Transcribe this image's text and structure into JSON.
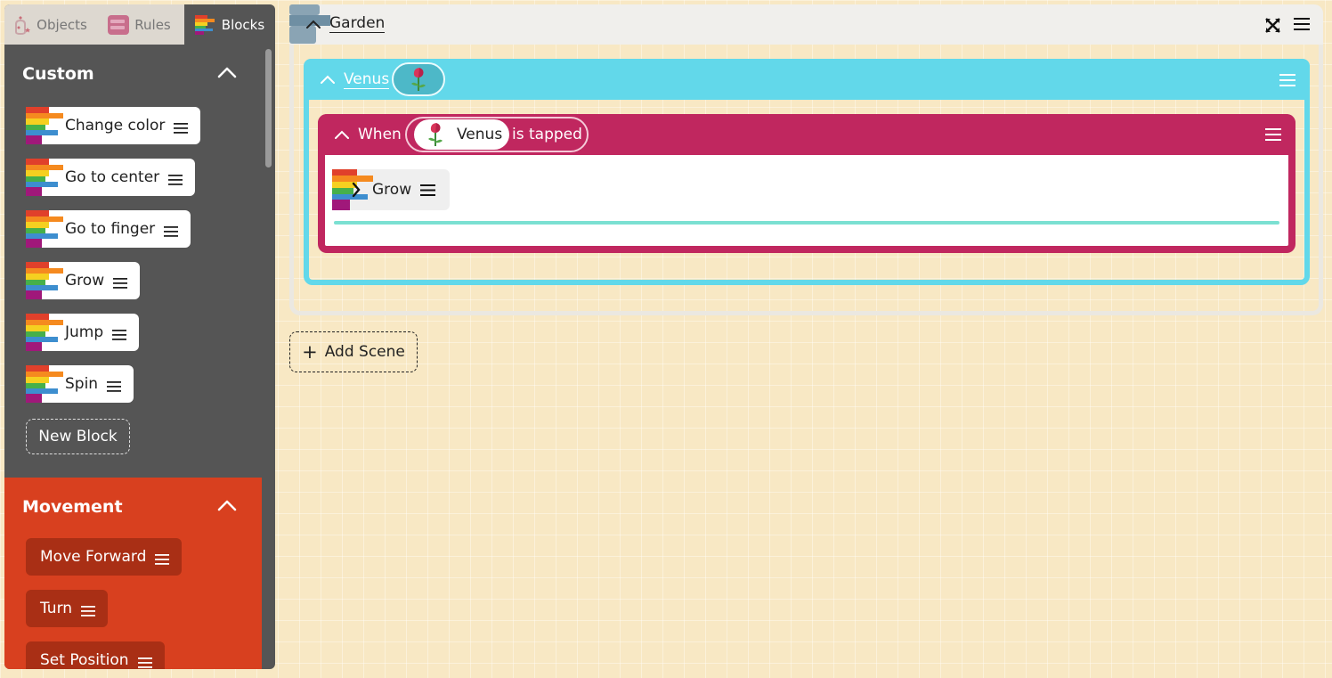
{
  "tabs": [
    {
      "label": "Objects",
      "icon": "objects-icon"
    },
    {
      "label": "Rules",
      "icon": "rules-icon"
    },
    {
      "label": "Blocks",
      "icon": "blocks-icon",
      "active": true
    }
  ],
  "custom": {
    "title": "Custom",
    "blocks": [
      "Change color",
      "Go to center",
      "Go to finger",
      "Grow",
      "Jump",
      "Spin"
    ],
    "new_block": "New Block",
    "color": "#555555"
  },
  "movement": {
    "title": "Movement",
    "blocks": [
      "Move Forward",
      "Turn",
      "Set Position"
    ],
    "color": "#d8401f"
  },
  "scene": {
    "title": "Garden",
    "object": {
      "name": "Venus",
      "rule": {
        "when": "When",
        "trigger_object": "Venus",
        "trigger_event": "is tapped",
        "blocks": [
          "Grow"
        ]
      }
    }
  },
  "add_scene": {
    "plus": "+",
    "label": "Add Scene"
  },
  "colors": {
    "object_accent": "#62d8ea",
    "rule_accent": "#c0275f",
    "canvas": "#f8e8c4"
  }
}
